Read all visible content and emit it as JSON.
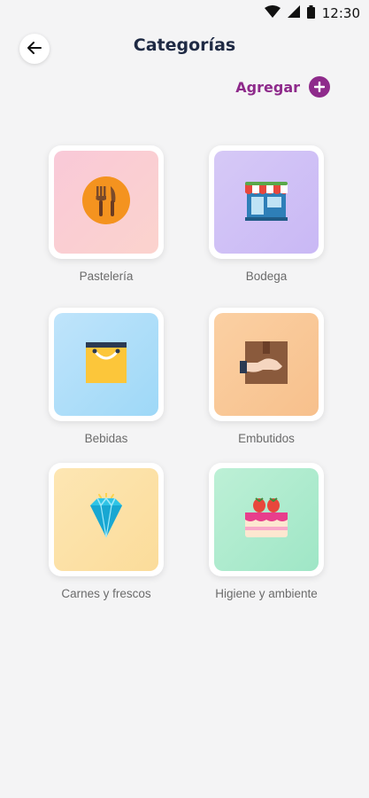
{
  "status": {
    "time": "12:30"
  },
  "header": {
    "title": "Categorías"
  },
  "actions": {
    "add_label": "Agregar"
  },
  "categories": [
    {
      "label": "Pastelería",
      "icon": "utensils-icon",
      "color_from": "#f9c9d8",
      "color_to": "#fbd3cd"
    },
    {
      "label": "Bodega",
      "icon": "store-icon",
      "color_from": "#d6c9f6",
      "color_to": "#c9b8f5"
    },
    {
      "label": "Bebidas",
      "icon": "shopping-bag-icon",
      "color_from": "#bfe4fb",
      "color_to": "#9ed8f7"
    },
    {
      "label": "Embutidos",
      "icon": "delivery-box-icon",
      "color_from": "#fbd0a3",
      "color_to": "#f7c08c"
    },
    {
      "label": "Carnes y frescos",
      "icon": "diamond-icon",
      "color_from": "#fde6b3",
      "color_to": "#fbdc9a"
    },
    {
      "label": "Higiene y ambiente",
      "icon": "cake-icon",
      "color_from": "#bdf0d6",
      "color_to": "#9fe6c6"
    }
  ],
  "colors": {
    "accent": "#8e2a8b",
    "title": "#1f2a44",
    "background": "#f4f4f5"
  }
}
